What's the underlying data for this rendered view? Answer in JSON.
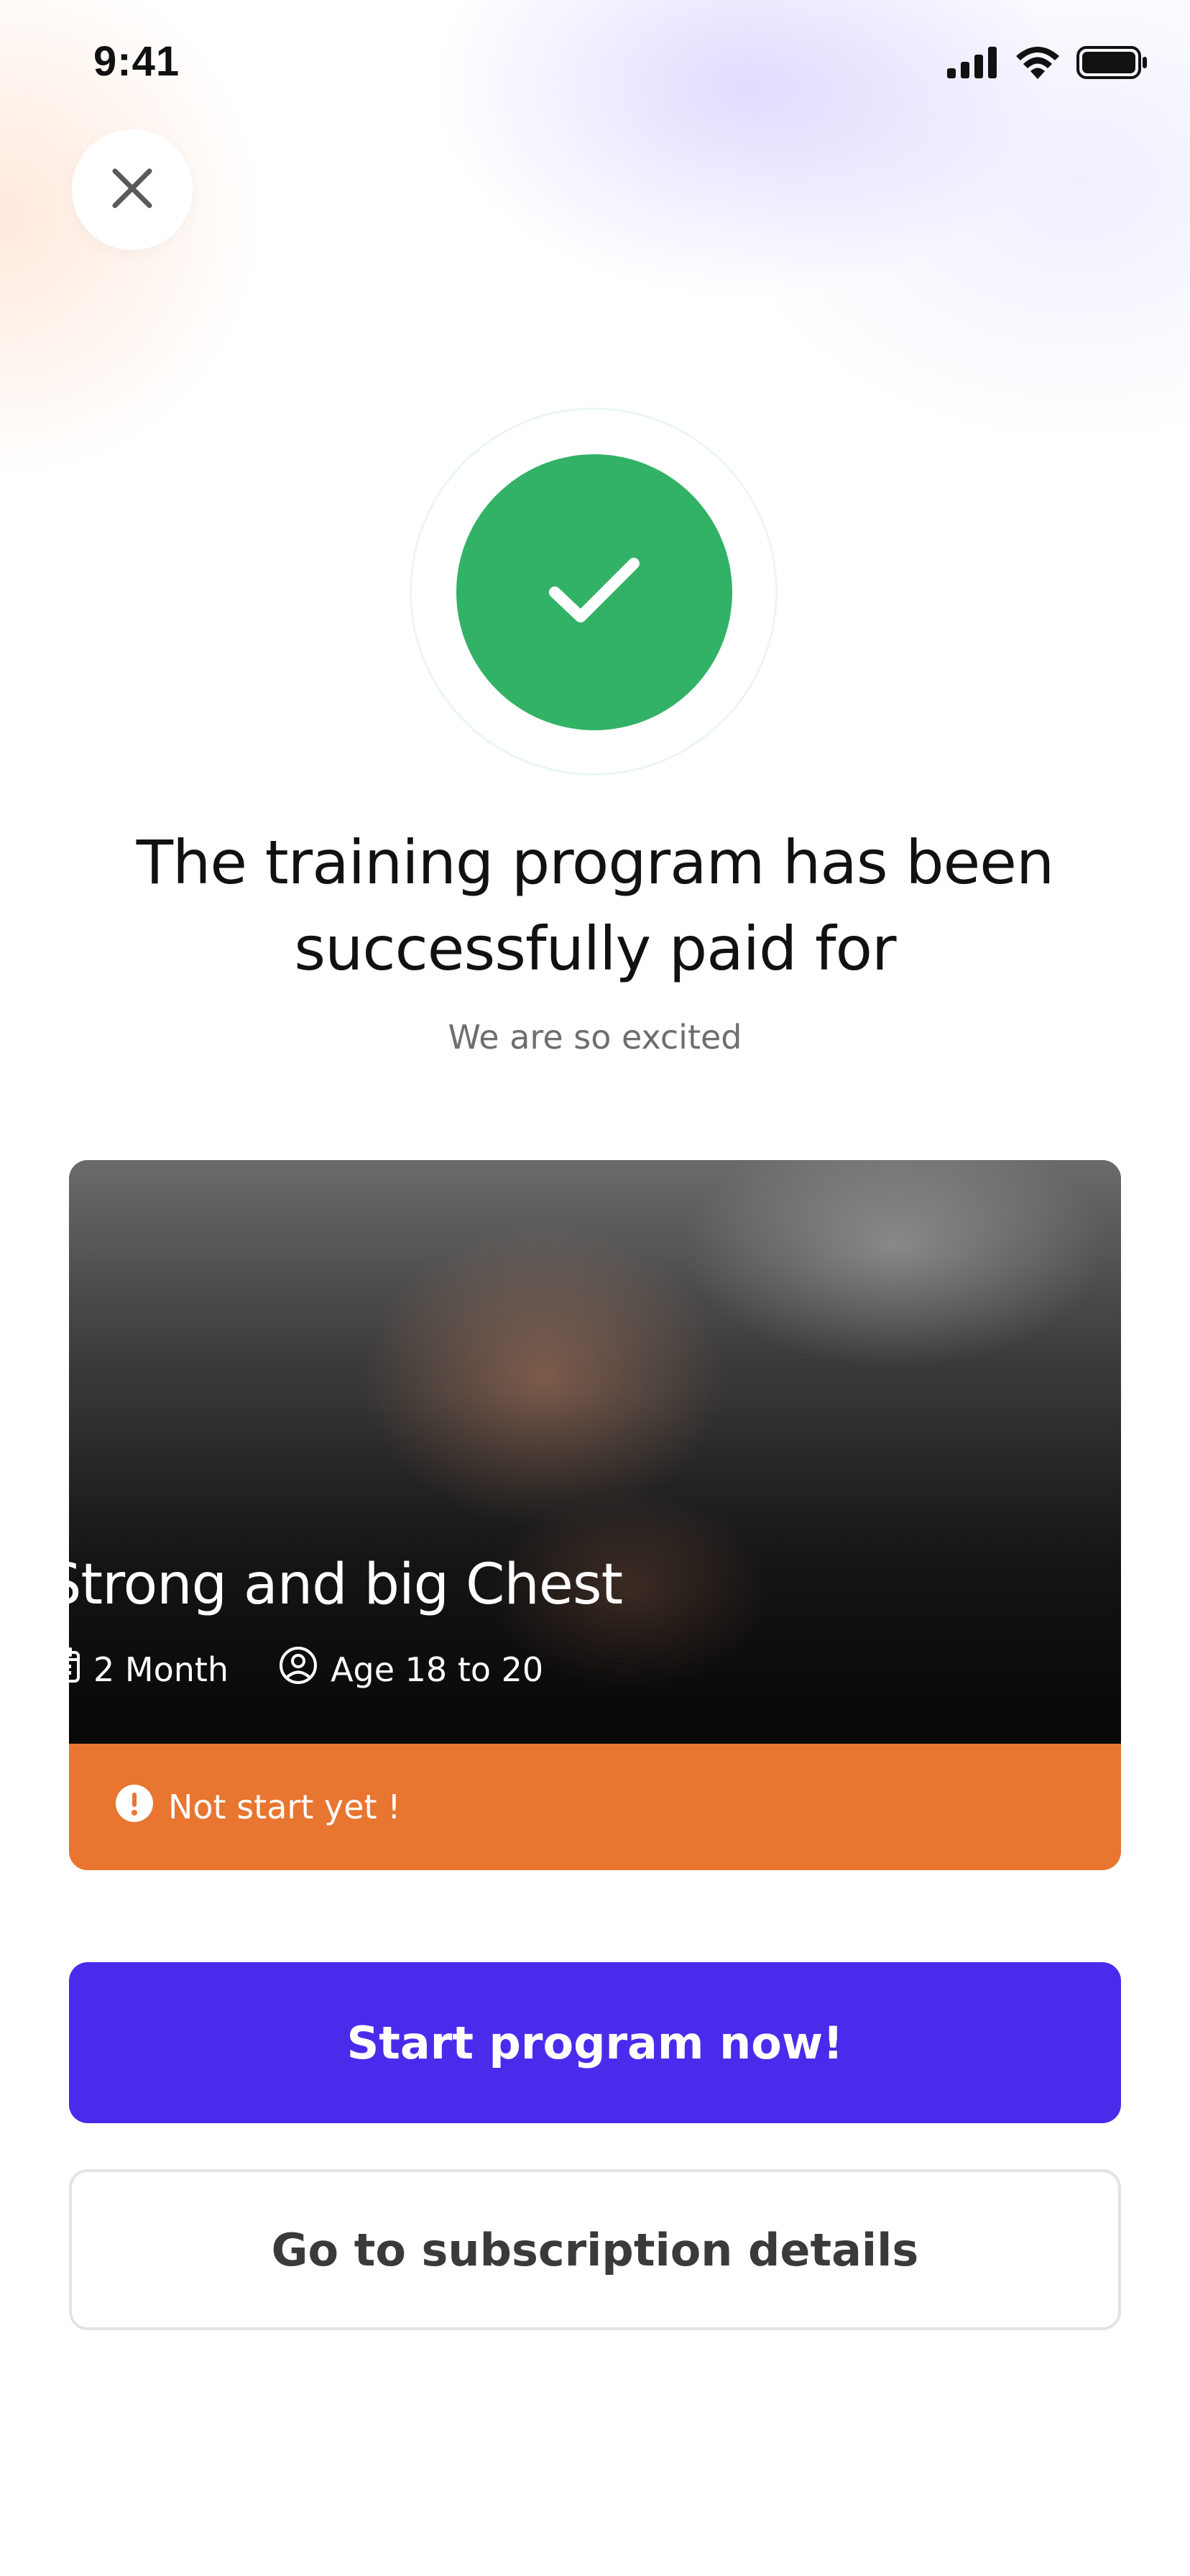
{
  "status_bar": {
    "time": "9:41"
  },
  "icons": {
    "close": "close-icon",
    "success": "checkmark-icon",
    "calendar": "calendar-icon",
    "user": "user-icon",
    "alert": "alert-icon",
    "signal": "signal-icon",
    "wifi": "wifi-icon",
    "battery": "battery-icon"
  },
  "colors": {
    "success_green": "#32b266",
    "warning_orange": "#e87530",
    "primary_purple": "#4a2bec"
  },
  "content": {
    "title": "The training program has been successfully paid for",
    "subtitle": "We are so excited"
  },
  "program": {
    "name": "Strong and big Chest",
    "duration": "2 Month",
    "age_range": "Age 18 to 20",
    "status": "Not start yet !"
  },
  "actions": {
    "start_label": "Start program now!",
    "details_label": "Go to subscription details"
  }
}
